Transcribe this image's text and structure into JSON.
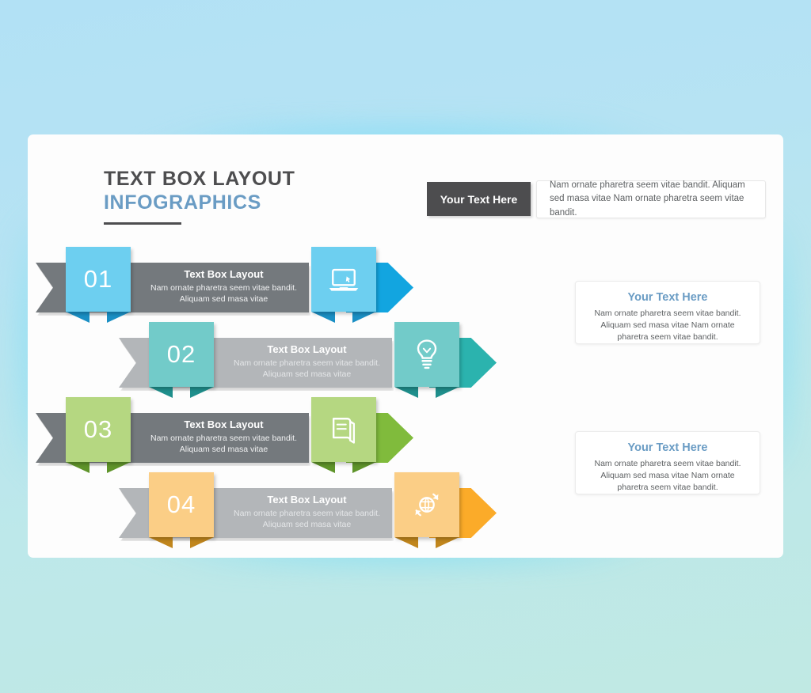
{
  "header": {
    "title_line1": "TEXT BOX LAYOUT",
    "title_line2": "INFOGRAPHICS"
  },
  "top_banner": {
    "tab_label": "Your Text Here",
    "body_text": "Nam ornate pharetra seem vitae bandit. Aliquam sed masa vitae Nam ornate pharetra seem vitae bandit."
  },
  "rows": [
    {
      "number": "01",
      "title": "Text Box Layout",
      "desc": "Nam ornate pharetra seem vitae bandit. Aliquam sed masa vitae",
      "icon": "laptop-icon",
      "accent": "#6dcff0",
      "accent_dark": "#12a5e0",
      "accent_shadow": "#1a8fc4",
      "band": "#74797d"
    },
    {
      "number": "02",
      "title": "Text Box Layout",
      "desc": "Nam ornate pharetra seem vitae bandit. Aliquam sed masa vitae",
      "icon": "lightbulb-icon",
      "accent": "#72cbc9",
      "accent_dark": "#2bb3ae",
      "accent_shadow": "#1f8f8c",
      "band": "#b3b6b9"
    },
    {
      "number": "03",
      "title": "Text Box Layout",
      "desc": "Nam ornate pharetra seem vitae bandit. Aliquam sed masa vitae",
      "icon": "book-icon",
      "accent": "#b5d781",
      "accent_dark": "#80bb3c",
      "accent_shadow": "#5f942a",
      "band": "#74797d"
    },
    {
      "number": "04",
      "title": "Text Box Layout",
      "desc": "Nam ornate pharetra seem vitae bandit. Aliquam sed masa vitae",
      "icon": "globe-refresh-icon",
      "accent": "#fbce86",
      "accent_dark": "#fbab29",
      "accent_shadow": "#c1861d",
      "band": "#b3b6b9"
    }
  ],
  "side_cards": [
    {
      "heading": "Your Text Here",
      "body": "Nam ornate pharetra seem vitae bandit. Aliquam sed masa vitae Nam ornate pharetra seem vitae bandit."
    },
    {
      "heading": "Your Text Here",
      "body": "Nam ornate pharetra seem vitae bandit. Aliquam sed masa vitae Nam ornate pharetra seem vitae bandit."
    }
  ],
  "theme": {
    "title_dark": "#4d4d4f",
    "title_blue": "#6a9cc4",
    "background_top": "#b2e1f5",
    "background_bottom": "#c0e9e3",
    "glow": "#63d2f7",
    "panel": "#fdfdfd"
  }
}
